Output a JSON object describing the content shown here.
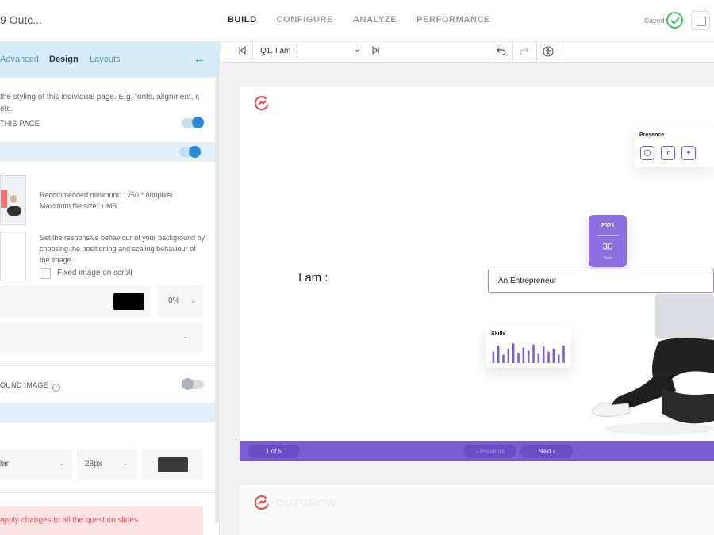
{
  "header": {
    "title": "9 Outc...",
    "nav": [
      "BUILD",
      "CONFIGURE",
      "ANALYZE",
      "PERFORMANCE"
    ],
    "active_nav": "BUILD",
    "saved_label": "Saved",
    "icons": [
      "check-icon",
      "preview-icon"
    ]
  },
  "left_panel": {
    "tabs": [
      "Advanced",
      "Design",
      "Layouts"
    ],
    "active_tab": "Design",
    "description": "the styling of this individual page. E.g. fonts, alignment, r, etc.",
    "this_page_label": "THIS PAGE",
    "image_info": {
      "min": "Recommended minimum: 1250 * 800pixel",
      "size": "Maximum file size: 1 MB"
    },
    "responsive_text": "Set the responsive behaviour of your background by choosing the positioning and scaling behaviour of the image.",
    "fixed_image_label": "Fixed image on scroll",
    "overlay_color": "#000000",
    "opacity": "0%",
    "round_image_label": "OUND IMAGE",
    "font_name": "lar",
    "font_size": "28px",
    "font_color": "#3a3a3a",
    "apply_text": "apply changes to all the question slides"
  },
  "toolbar": {
    "question_select": "Q1. I am :",
    "icons": [
      "first-slide-icon",
      "last-slide-icon",
      "undo-icon",
      "redo-icon",
      "accessibility-icon"
    ]
  },
  "slide": {
    "presence_title": "Presence",
    "socials": [
      "instagram-icon",
      "linkedin-icon",
      "twitter-icon"
    ],
    "date": {
      "year": "2021",
      "day": "30",
      "weekday": "Tues"
    },
    "question_label": "I am :",
    "answer_value": "An Entrepreneur",
    "skills_title": "Skills",
    "skills_values": [
      0.55,
      0.85,
      0.4,
      0.7,
      0.95,
      0.5,
      0.75,
      0.6,
      0.9,
      0.45,
      0.8,
      0.55,
      0.7,
      0.4,
      0.85
    ],
    "page_indicator": "1 of 5",
    "previous_label": "Previous",
    "next_label": "Next"
  },
  "second_slide": {
    "brand": "OUTGROW"
  },
  "colors": {
    "accent": "#7b5cd6",
    "brand": "#e8474b",
    "panel_blue": "#2e8ad8",
    "saved_green": "#3cc45e"
  }
}
